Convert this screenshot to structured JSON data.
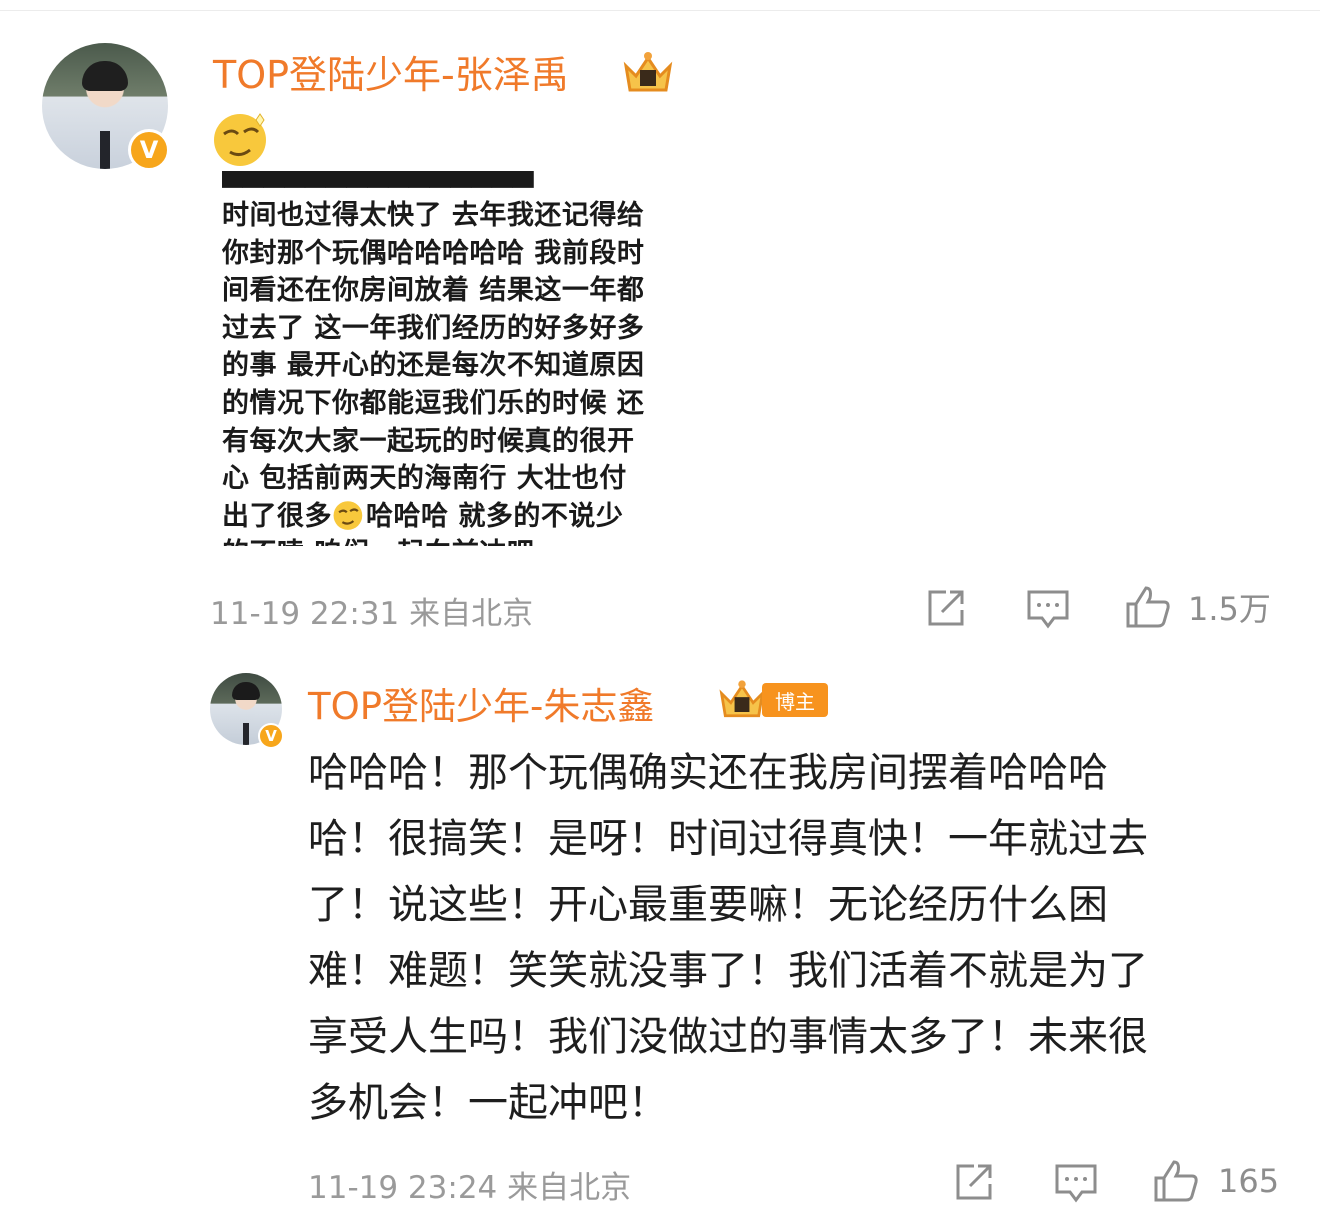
{
  "comment1": {
    "username": "TOP登陆少年-张泽禹",
    "emoji": "smirk-emoji",
    "screenshot_lines": [
      "时间也过得太快了 去年我还记得给",
      "你封那个玩偶哈哈哈哈哈 我前段时",
      "间看还在你房间放着 结果这一年都",
      "过去了 这一年我们经历的好多好多",
      "的事 最开心的还是每次不知道原因",
      "的情况下你都能逗我们乐的时候 还",
      "有每次大家一起玩的时候真的很开",
      "心 包括前两天的海南行 大壮也付"
    ],
    "screenshot_line9_a": "出了很多",
    "screenshot_line9_b": "哈哈哈 就多的不说少",
    "screenshot_line10": "的不嗦 咱们一起向前冲吧",
    "time": "11-19 22:31",
    "source": "来自北京",
    "likes": "1.5万"
  },
  "comment2": {
    "username": "TOP登陆少年-朱志鑫",
    "badge": "博主",
    "text_lines": [
      "哈哈哈！那个玩偶确实还在我房间摆着哈哈哈",
      "哈！很搞笑！是呀！时间过得真快！一年就过去",
      "了！说这些！开心最重要嘛！无论经历什么困",
      "难！难题！笑笑就没事了！我们活着不就是为了",
      "享受人生吗！我们没做过的事情太多了！未来很",
      "多机会！一起冲吧！"
    ],
    "time": "11-19 23:24",
    "source": "来自北京",
    "likes": "165"
  },
  "colors": {
    "accent": "#f07a2a",
    "meta": "#9a9a9a",
    "badge": "#f7931e",
    "verified": "#f7a61b"
  }
}
